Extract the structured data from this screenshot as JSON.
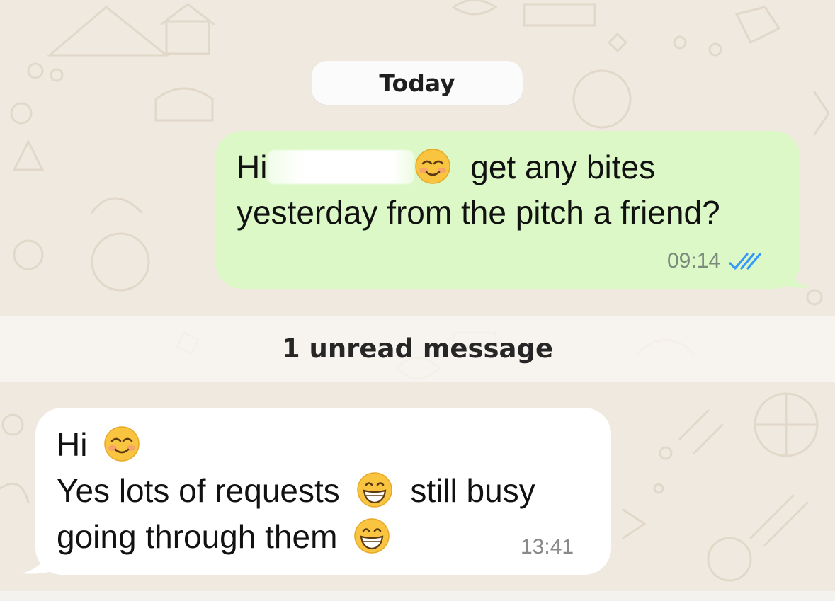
{
  "chat": {
    "date_label": "Today",
    "unread_label": "1 unread message"
  },
  "messages": [
    {
      "direction": "outgoing",
      "text_prefix": "Hi",
      "emoji_1": "smiling-face-icon",
      "line1_rest": "get any bites",
      "line2": "yesterday from the pitch a friend?",
      "time": "09:14",
      "status": "double-check-icon",
      "bubble_color": "#dbf8c6"
    },
    {
      "direction": "incoming",
      "line1": "Hi",
      "line2_a": "Yes lots of requests",
      "line2_b": "still busy",
      "line3": "going through them",
      "time": "13:41",
      "bubble_color": "#ffffff"
    }
  ],
  "colors": {
    "wallpaper": "#efe9df",
    "read_check": "#3497f9"
  }
}
